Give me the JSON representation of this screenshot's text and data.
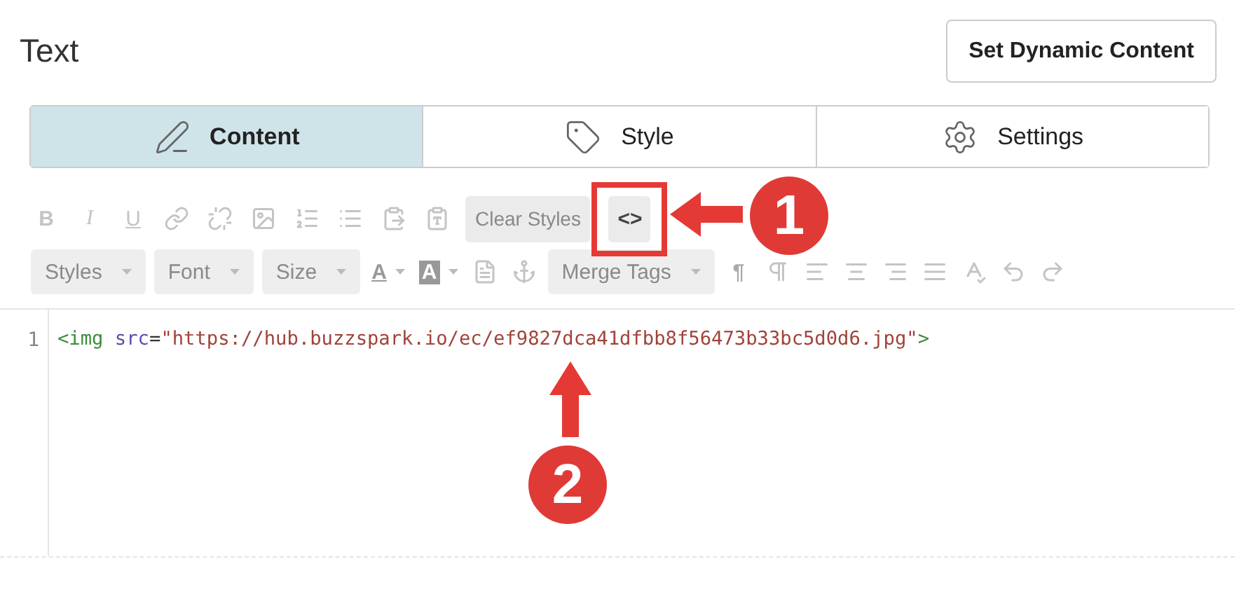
{
  "title": "Text",
  "dynamic_button": "Set Dynamic Content",
  "tabs": [
    {
      "label": "Content",
      "selected": true
    },
    {
      "label": "Style",
      "selected": false
    },
    {
      "label": "Settings",
      "selected": false
    }
  ],
  "toolbar_row_1": [
    {
      "kind": "bold",
      "text": "B"
    },
    {
      "kind": "italic",
      "text": "I"
    },
    {
      "kind": "underline",
      "text": "U"
    },
    {
      "kind": "icon"
    },
    {
      "kind": "icon"
    },
    {
      "kind": "icon"
    },
    {
      "kind": "icon"
    },
    {
      "kind": "icon"
    },
    {
      "kind": "icon"
    },
    {
      "kind": "icon"
    },
    {
      "kind": "text",
      "text": "Clear Styles"
    },
    {
      "kind": "code",
      "text": "<>",
      "selected": true
    }
  ],
  "toolbar_row_2": [
    {
      "kind": "dropdown",
      "text": "Styles"
    },
    {
      "kind": "dropdown",
      "text": "Font"
    },
    {
      "kind": "dropdown",
      "text": "Size"
    },
    {
      "kind": "color",
      "text": "A"
    },
    {
      "kind": "bgcolor",
      "text": "A"
    },
    {
      "kind": "icon"
    },
    {
      "kind": "icon"
    },
    {
      "kind": "dropdown",
      "text": "Merge Tags"
    },
    {
      "kind": "glyph",
      "text": "¶"
    },
    {
      "kind": "icon"
    },
    {
      "kind": "icon"
    },
    {
      "kind": "icon"
    },
    {
      "kind": "icon"
    },
    {
      "kind": "icon"
    },
    {
      "kind": "icon"
    },
    {
      "kind": "icon"
    },
    {
      "kind": "icon"
    }
  ],
  "editor": {
    "lines": [
      {
        "number": "1",
        "tokens": [
          {
            "kind": "tag",
            "text": "<img"
          },
          {
            "kind": "attr",
            "text": " src"
          },
          {
            "kind": "punct",
            "text": "="
          },
          {
            "kind": "string",
            "text": "\"https://hub.buzzspark.io/ec/ef9827dca41dfbb8f56473b33bc5d0d6.jpg\""
          },
          {
            "kind": "tag",
            "text": ">"
          }
        ]
      }
    ]
  },
  "callouts": [
    {
      "number": "1"
    },
    {
      "number": "2"
    }
  ]
}
